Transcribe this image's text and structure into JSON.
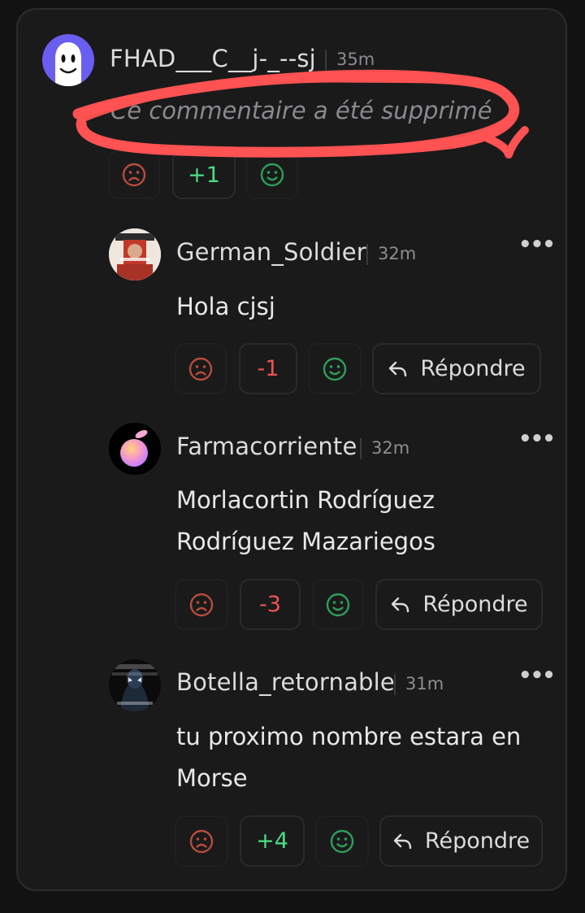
{
  "root_comment": {
    "username": "FHAD___C__j-_--sj",
    "time": "35m",
    "text": "Ce commentaire a été supprimé",
    "score": "+1",
    "annotation_color": "#ff4d4d"
  },
  "replies": [
    {
      "username": "German_Soldier",
      "time": "32m",
      "lines": [
        "Hola cjsj"
      ],
      "score": "-1",
      "reply_label": "Répondre"
    },
    {
      "username": "Farmacorriente",
      "time": "32m",
      "lines": [
        "Morlacortin Rodríguez",
        "Rodríguez Mazariegos"
      ],
      "score": "-3",
      "reply_label": "Répondre"
    },
    {
      "username": "Botella_retornable",
      "time": "31m",
      "lines": [
        "tu proximo nombre estara en",
        "Morse"
      ],
      "score": "+4",
      "reply_label": "Répondre"
    }
  ],
  "colors": {
    "background": "#121212",
    "card": "#1a1a1b",
    "positive": "#4ade80",
    "negative": "#ef5350",
    "frown_icon": "#b84c3c",
    "smile_icon": "#2e9e57"
  }
}
